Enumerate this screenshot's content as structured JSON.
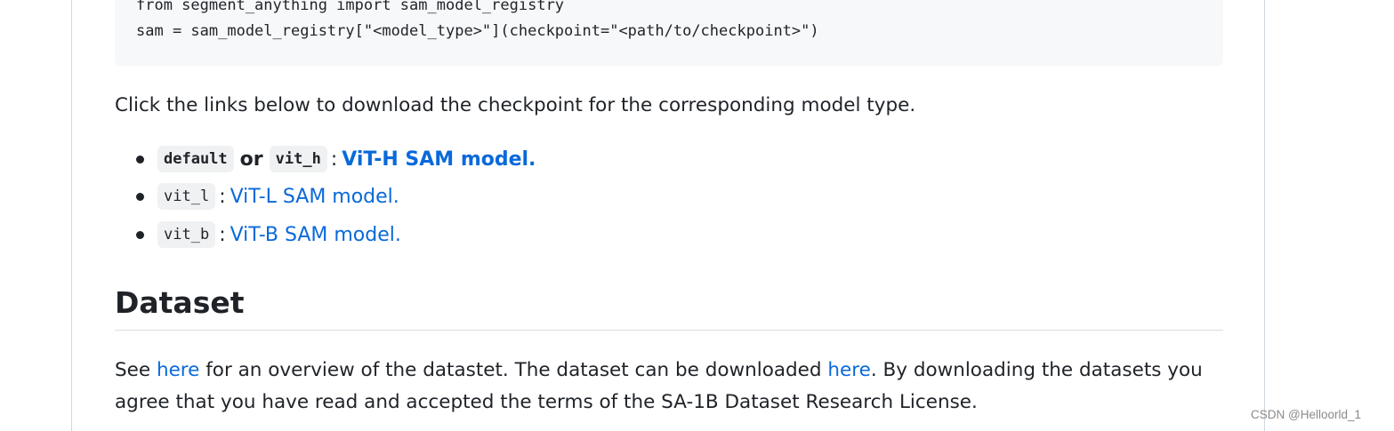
{
  "code": {
    "lines": [
      "from segment_anything import sam_model_registry",
      "sam = sam_model_registry[\"<model_type>\"](checkpoint=\"<path/to/checkpoint>\")"
    ]
  },
  "intro": "Click the links below to download the checkpoint for the corresponding model type.",
  "checkpoints": {
    "items": [
      {
        "code_a": "default",
        "or_label": "or",
        "code_b": "vit_h",
        "colon": ":",
        "link": "ViT-H SAM model."
      },
      {
        "code_a": "vit_l",
        "colon": ":",
        "link": "ViT-L SAM model."
      },
      {
        "code_a": "vit_b",
        "colon": ":",
        "link": "ViT-B SAM model."
      }
    ]
  },
  "dataset": {
    "heading": "Dataset",
    "line1_a": "See ",
    "line1_link1": "here",
    "line1_b": " for an overview of the datastet. The dataset can be downloaded ",
    "line1_link2": "here",
    "line1_c": ". By downloading the datasets you",
    "line2": "agree that you have read and accepted the terms of the SA-1B Dataset Research License."
  },
  "watermark": "CSDN @Helloorld_1"
}
